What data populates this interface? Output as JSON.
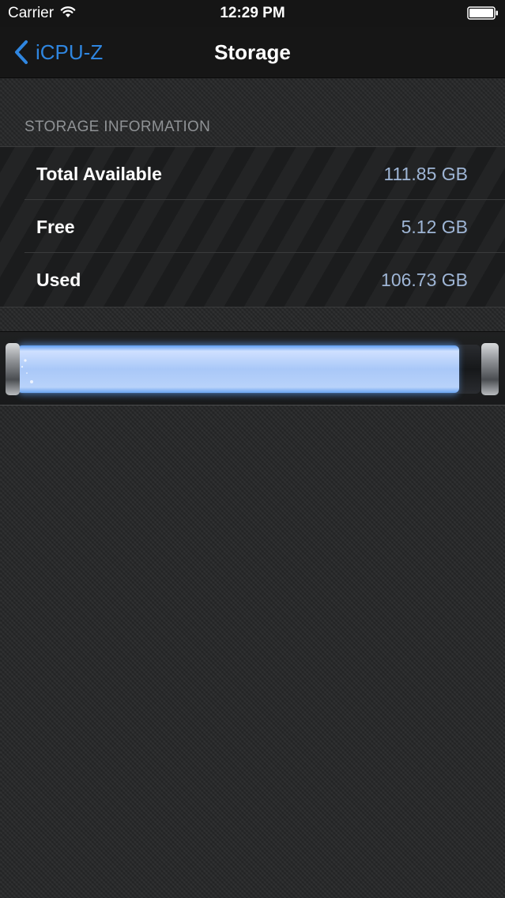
{
  "status_bar": {
    "carrier": "Carrier",
    "time": "12:29 PM",
    "wifi_icon": "wifi-icon",
    "battery_icon": "battery-icon"
  },
  "nav": {
    "back_label": "iCPU-Z",
    "back_icon": "chevron-left-icon",
    "title": "Storage"
  },
  "section_header": "STORAGE INFORMATION",
  "rows": [
    {
      "label": "Total Available",
      "value": "111.85 GB"
    },
    {
      "label": "Free",
      "value": "5.12 GB"
    },
    {
      "label": "Used",
      "value": "106.73 GB"
    }
  ],
  "storage_bar": {
    "used_fraction": 0.954,
    "fill_color": "#a9c8f8",
    "glow_color": "#5c9cf0"
  },
  "colors": {
    "accent": "#2f86e0",
    "value_text": "#9fb6d6",
    "section_header": "#8f9295"
  }
}
